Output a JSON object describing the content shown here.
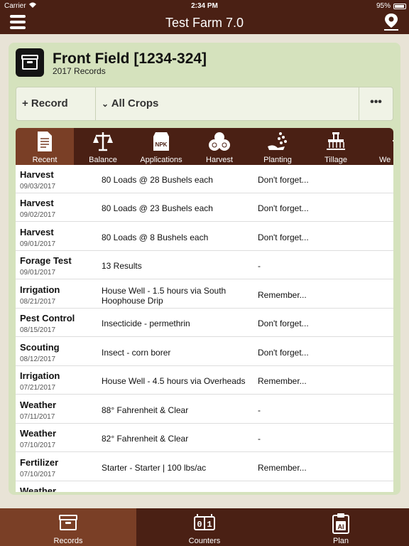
{
  "status": {
    "carrier": "Carrier",
    "time": "2:34 PM",
    "battery": "95%"
  },
  "header": {
    "title": "Test Farm 7.0"
  },
  "field": {
    "name": "Front Field [1234-324]",
    "subtitle": "2017 Records"
  },
  "toolbar": {
    "record_label": "+ Record",
    "crops_label": "All Crops",
    "more_label": "•••"
  },
  "tabs": [
    {
      "label": "Recent",
      "icon": "document-icon"
    },
    {
      "label": "Balance",
      "icon": "scale-icon"
    },
    {
      "label": "Applications",
      "icon": "fertilizer-bag-icon"
    },
    {
      "label": "Harvest",
      "icon": "hay-bales-icon"
    },
    {
      "label": "Planting",
      "icon": "seed-planting-icon"
    },
    {
      "label": "Tillage",
      "icon": "tractor-icon"
    },
    {
      "label": "We",
      "icon": "weather-icon"
    }
  ],
  "records": [
    {
      "type": "Harvest",
      "date": "09/03/2017",
      "desc": "80 Loads @ 28 Bushels each",
      "note": "Don't forget..."
    },
    {
      "type": "Harvest",
      "date": "09/02/2017",
      "desc": "80 Loads @ 23 Bushels each",
      "note": "Don't forget..."
    },
    {
      "type": "Harvest",
      "date": "09/01/2017",
      "desc": "80 Loads @ 8 Bushels each",
      "note": "Don't forget..."
    },
    {
      "type": "Forage Test",
      "date": "09/01/2017",
      "desc": "13 Results",
      "note": "-"
    },
    {
      "type": "Irrigation",
      "date": "08/21/2017",
      "desc": "House Well - 1.5 hours via South Hoophouse Drip",
      "note": "Remember..."
    },
    {
      "type": "Pest Control",
      "date": "08/15/2017",
      "desc": "Insecticide - permethrin",
      "note": "Don't forget..."
    },
    {
      "type": "Scouting",
      "date": "08/12/2017",
      "desc": "Insect - corn borer",
      "note": "Don't forget..."
    },
    {
      "type": "Irrigation",
      "date": "07/21/2017",
      "desc": "House Well - 4.5 hours via Overheads",
      "note": "Remember..."
    },
    {
      "type": "Weather",
      "date": "07/11/2017",
      "desc": "88° Fahrenheit & Clear",
      "note": "-"
    },
    {
      "type": "Weather",
      "date": "07/10/2017",
      "desc": "82° Fahrenheit & Clear",
      "note": "-"
    },
    {
      "type": "Fertilizer",
      "date": "07/10/2017",
      "desc": "Starter - Starter | 100 lbs/ac",
      "note": "Remember..."
    },
    {
      "type": "Weather",
      "date": "",
      "desc": "",
      "note": ""
    }
  ],
  "bottom_tabs": [
    {
      "label": "Records",
      "icon": "records-box-icon"
    },
    {
      "label": "Counters",
      "icon": "counter-icon"
    },
    {
      "label": "Plan",
      "icon": "clipboard-ai-icon"
    }
  ],
  "colors": {
    "nav_brown": "#4a2014",
    "active_brown": "#7a3f26",
    "card_green": "#d5e2bd"
  }
}
